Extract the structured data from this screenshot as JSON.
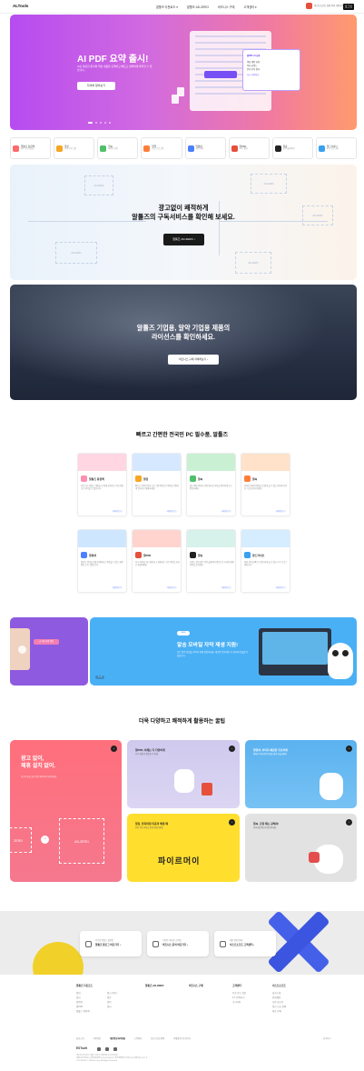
{
  "header": {
    "logo": "ALTools",
    "nav": [
      "알툴즈 다운로드 ▾",
      "알툴즈 AD-ZERO",
      "비즈니스 구매",
      "고객센터 ▾"
    ],
    "ad_chip": "이스트소프트 보안 무료 다운로드",
    "login": "로그인"
  },
  "hero": {
    "title": "AI PDF 요약 출시!",
    "subtitle": "AI로 복잡한 문서의 핵심 내용을 요약하고 빠르고 정확하게 파악할 수 있습니다.",
    "button": "자세히 알아보기",
    "popup_title": "알PDF AI 요약",
    "popup_lines": [
      "핵심 내용 요약",
      "주요 키워드",
      "문서 분석 결과",
      "다시 요약하기"
    ]
  },
  "apps": [
    {
      "name": "알툴즈 통합팩",
      "desc": "자주 쓰는 알툴즈",
      "color": "#ff6a6a"
    },
    {
      "name": "알집",
      "desc": "압축 프로그램",
      "color": "#f5a623"
    },
    {
      "name": "알씨",
      "desc": "이미지 뷰어",
      "color": "#4fc06a"
    },
    {
      "name": "알약",
      "desc": "백신 프로그램",
      "color": "#ff7d3b"
    },
    {
      "name": "알캡처",
      "desc": "화면 캡처",
      "color": "#4c7fff"
    },
    {
      "name": "알PDF",
      "desc": "PDF 편집",
      "color": "#e5503c"
    },
    {
      "name": "알송",
      "desc": "음악 플레이어",
      "color": "#222222"
    },
    {
      "name": "알드라이브",
      "desc": "FTP 프로그램",
      "color": "#3aa0f0"
    }
  ],
  "subscribe": {
    "heading_line1": "광고없이 쾌적하게",
    "heading_line2": "알툴즈의 구독서비스를 확인해 보세요.",
    "button": "알툴즈 AD-ZERO  ›",
    "frames": [
      "AD-ZERO",
      "AD-ZERO",
      "AD-ZERO",
      "AD-ZERO",
      "AD-ZERO"
    ]
  },
  "license": {
    "heading_line1": "알툴즈 기업용, 알약 기업용 제품의",
    "heading_line2": "라이선스를 확인하세요.",
    "button": "비즈니스 구매 자세히보기  ›"
  },
  "section1": {
    "title": "빠르고 간편한 전국민 PC 필수품, 알툴즈",
    "cards": [
      {
        "name": "알툴즈 통합팩",
        "desc": "자주 쓰는 알툴즈 제품을 한 번에 설치하고 최신 버전으로 관리할 수 있습니다.",
        "more": "자세히보기 ›",
        "color": "#ff8fb0",
        "top": "#ffd6e2"
      },
      {
        "name": "알집",
        "desc": "빠르고 안전한 압축 프로그램 알집으로 파일을 간편하게 압축하고 해제하세요.",
        "more": "자세히보기 ›",
        "color": "#f5a623",
        "top": "#d6e8ff"
      },
      {
        "name": "알씨",
        "desc": "쉽고 빠른 이미지 뷰어 알씨로 사진을 편리하게 보고 편집하세요.",
        "more": "자세히보기 ›",
        "color": "#4fc06a",
        "top": "#c9f0d2"
      },
      {
        "name": "알씨",
        "desc": "이미지 변환과 편집을 손쉽게 할 수 있는 알씨의 다양한 기능을 만나보세요.",
        "more": "자세히보기 ›",
        "color": "#ff7d3b",
        "top": "#ffe2c9"
      },
      {
        "name": "알캡처",
        "desc": "원하는 영역을 손쉽게 캡처하고 편집할 수 있는 화면 캡처 프로그램입니다.",
        "more": "자세히보기 ›",
        "color": "#4c7fff",
        "top": "#cfe6ff"
      },
      {
        "name": "알PDF",
        "desc": "PDF 파일을 열고 편집하고 변환하는 모든 작업을 하나로 해결하세요.",
        "more": "자세히보기 ›",
        "color": "#e5503c",
        "top": "#ffd4cf"
      },
      {
        "name": "알송",
        "desc": "가볍고 음질 좋은 음악 플레이어 알송으로 가사와 함께 음악을 즐기세요.",
        "more": "자세히보기 ›",
        "color": "#222222",
        "top": "#d7f2ea"
      },
      {
        "name": "알드라이브",
        "desc": "파일 전송을 빠르고 편리하게 할 수 있는 FTP 프로그램입니다.",
        "more": "자세히보기 ›",
        "color": "#3aa0f0",
        "top": "#d6ecff"
      }
    ]
  },
  "promo": {
    "left_tag": "★ 자동 자막 생성",
    "badge": "NEW",
    "heading": "알송 모바일 자막 재생 지원!",
    "desc": "모든 음악 영상을 자막과 함께 감상하세요. 새로운 알송에서 더 편리하게 즐길 수 있습니다.",
    "counter": "2 / 3"
  },
  "section2": {
    "title": "더욱 다양하고 쾌적하게 활용하는 꿀팁",
    "big": {
      "heading_line1": "광고 없이,",
      "heading_line2": "제휴 설치 없이.",
      "desc": "광고와 제휴 설치 없이 쾌적하게 사용하세요.",
      "frame1": "ZERO",
      "frame2": "AD-ZERO"
    },
    "tip_a": {
      "title": "알PDF, 이제는 더 다양하게",
      "desc": "PDF 변환과 편집을 더 쉽게"
    },
    "tip_b": {
      "title": "알캡처, 이미지 채굴을 무료하세",
      "desc": "캡처한 이미지의 글자를 쉽게 추출하세요."
    },
    "tip_c": {
      "title": "알집, 압축파일 미흡의 해결 때",
      "desc": "알집 압축 파일을 쉽게 해결하세요.",
      "logo": "파이르머이"
    },
    "tip_d": {
      "title": "알씨, 급할 때는 갈해서!",
      "desc": "이미지를 빠르게 편집하세요."
    }
  },
  "bottom_boxes": [
    {
      "small": "더 많은 알툴즈 활용법",
      "main": "알툴즈 블로그 바로가기 ›"
    },
    {
      "small": "기업용 라이선스 문의는",
      "main": "비즈니스 문의 바로가기 ›"
    },
    {
      "small": "제품 관련 문의는",
      "main": "이스트소프트 고객센터 ›"
    }
  ],
  "footer": {
    "cols": [
      {
        "title": "알툴즈 다운로드",
        "items": [
          "알집",
          "알씨",
          "알캡처",
          "알PDF",
          "알툴즈 통합팩"
        ]
      },
      {
        "title": "",
        "items": [
          "알드라이브",
          "알송",
          "알약",
          "알씨"
        ]
      },
      {
        "title": "알툴즈 AD-ZERO",
        "items": []
      },
      {
        "title": "비즈니스 구매",
        "items": []
      },
      {
        "title": "고객센터",
        "items": [
          "자주 묻는 질문",
          "1:1 문의하기",
          "공지사항"
        ]
      },
      {
        "title": "이스트소프트",
        "items": [
          "회사소개",
          "인재채용",
          "보안 권고문",
          "정보 보호 정책",
          "제휴 문의"
        ]
      }
    ],
    "bar": [
      "회사소개",
      "이용약관",
      "개인정보처리방침",
      "고객센터",
      "청소년보호정책",
      "이메일무단수집거부"
    ],
    "bar_bold_index": 2,
    "lang": "한국어 ▾",
    "brand": "ESTsoft",
    "info_line1": "(주)이스트소프트 서울시 서초구 반포대로 3 이스트빌딩",
    "info_line2": "대표이사 정상원 | 사업자등록번호 220-81-83517 | 통신판매업신고 제 2012-서울서초-0217 호",
    "info_line3": "COPYRIGHT © ESTsoft Corp. All Rights Reserved."
  }
}
